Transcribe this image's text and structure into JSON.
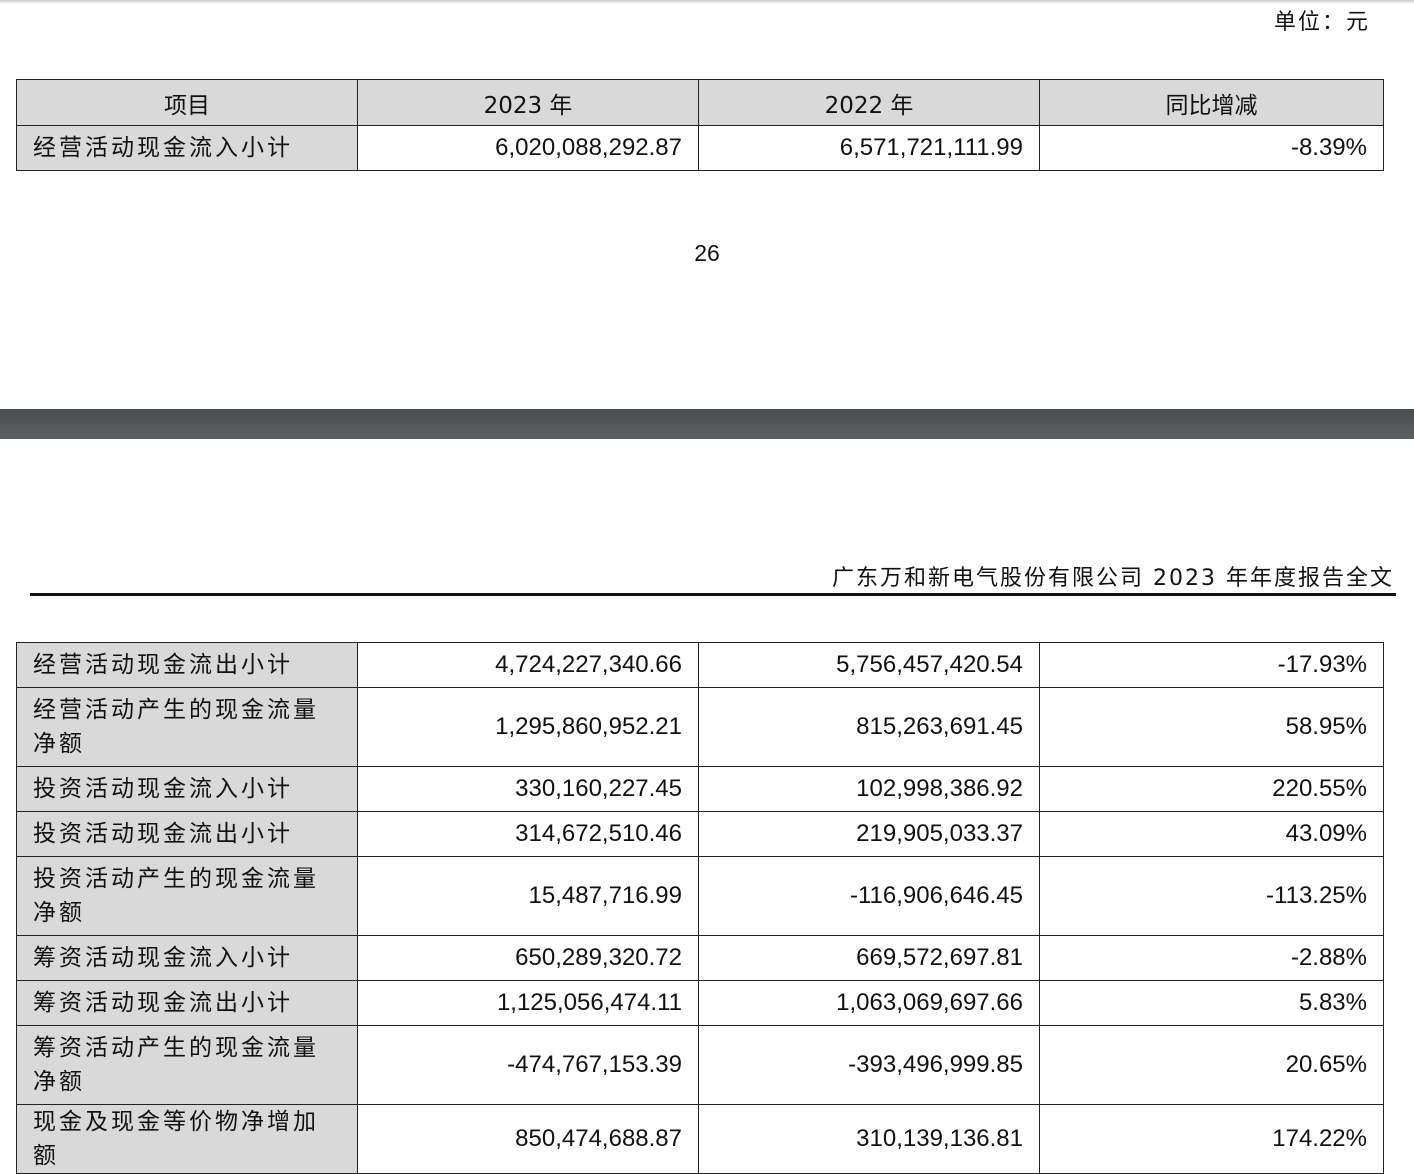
{
  "unit_label": "单位：元",
  "page_number": "26",
  "report_header": "广东万和新电气股份有限公司 2023 年年度报告全文",
  "table_top": {
    "headers": [
      "项目",
      "2023 年",
      "2022 年",
      "同比增减"
    ],
    "rows": [
      {
        "label": "经营活动现金流入小计",
        "y2023": "6,020,088,292.87",
        "y2022": "6,571,721,111.99",
        "change": "-8.39%"
      }
    ]
  },
  "table_bottom": {
    "rows": [
      {
        "label": "经营活动现金流出小计",
        "y2023": "4,724,227,340.66",
        "y2022": "5,756,457,420.54",
        "change": "-17.93%"
      },
      {
        "label": "经营活动产生的现金流量净额",
        "y2023": "1,295,860,952.21",
        "y2022": "815,263,691.45",
        "change": "58.95%"
      },
      {
        "label": "投资活动现金流入小计",
        "y2023": "330,160,227.45",
        "y2022": "102,998,386.92",
        "change": "220.55%"
      },
      {
        "label": "投资活动现金流出小计",
        "y2023": "314,672,510.46",
        "y2022": "219,905,033.37",
        "change": "43.09%"
      },
      {
        "label": "投资活动产生的现金流量净额",
        "y2023": "15,487,716.99",
        "y2022": "-116,906,646.45",
        "change": "-113.25%"
      },
      {
        "label": "筹资活动现金流入小计",
        "y2023": "650,289,320.72",
        "y2022": "669,572,697.81",
        "change": "-2.88%"
      },
      {
        "label": "筹资活动现金流出小计",
        "y2023": "1,125,056,474.11",
        "y2022": "1,063,069,697.66",
        "change": "5.83%"
      },
      {
        "label": "筹资活动产生的现金流量净额",
        "y2023": "-474,767,153.39",
        "y2022": "-393,496,999.85",
        "change": "20.65%"
      },
      {
        "label": "现金及现金等价物净增加额",
        "y2023": "850,474,688.87",
        "y2022": "310,139,136.81",
        "change": "174.22%"
      }
    ]
  }
}
